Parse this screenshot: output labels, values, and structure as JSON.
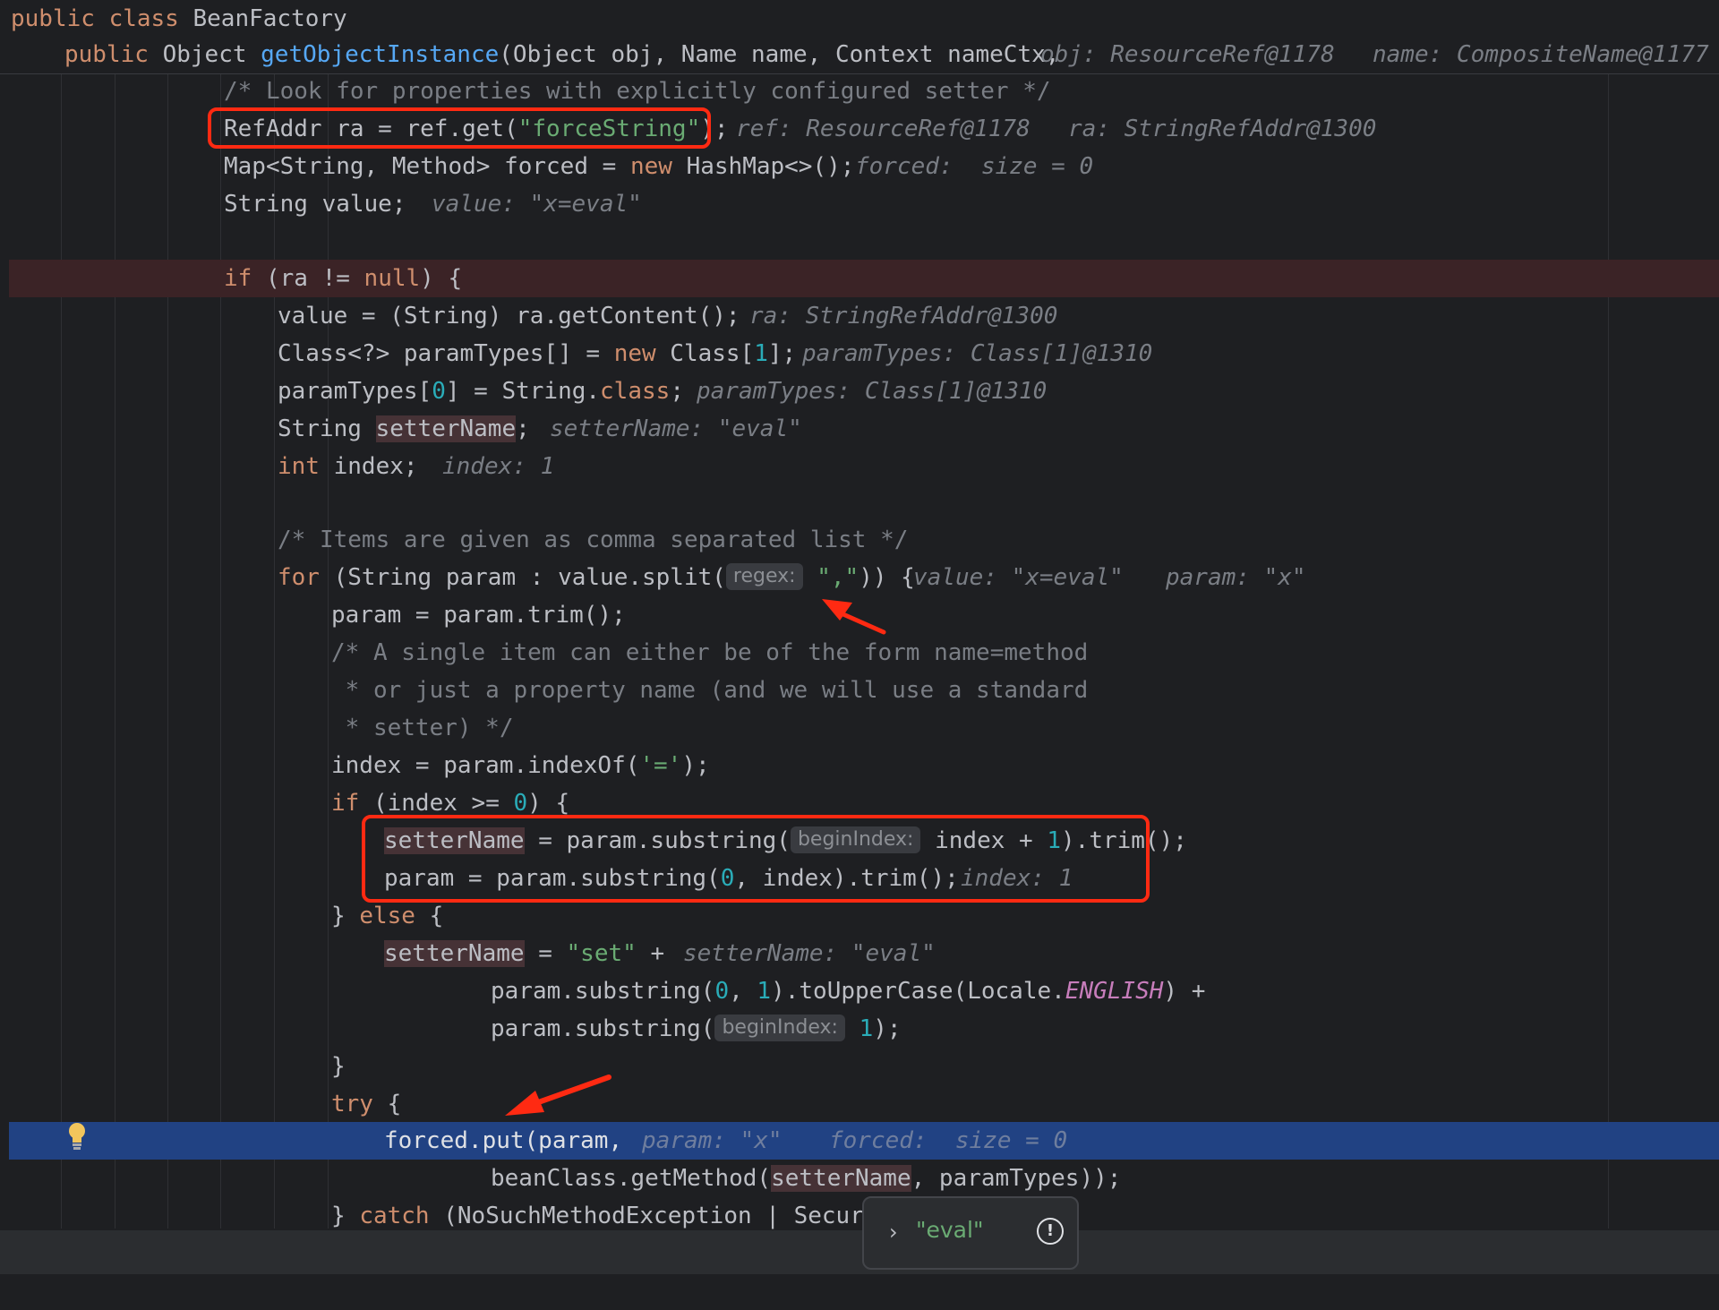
{
  "editor": {
    "header_line_1": {
      "kw": "public class",
      "rest": " BeanFactory"
    },
    "header_line_2": {
      "kw": "public",
      "type": " Object ",
      "method": "getObjectInstance",
      "params": "(Object obj, Name name, Context nameCtx,",
      "hint_obj": "obj: ResourceRef@1178",
      "hint_name": "name: CompositeName@1177"
    },
    "lines": {
      "l1": {
        "comment": "/* Look for properties with explicitly configured setter */"
      },
      "l2": {
        "pre": "RefAddr ra = ref.get(",
        "str": "\"forceString\"",
        "post": ");",
        "hint_ref": "ref: ResourceRef@1178",
        "hint_ra": "ra: StringRefAddr@1300"
      },
      "l3": {
        "pre": "Map<String, Method> forced = ",
        "kw": "new",
        "post": " HashMap<>();",
        "hint": "forced:  size = 0"
      },
      "l4": {
        "pre": "String value;",
        "hint": "value: \"x=eval\""
      },
      "l6": {
        "kw_if": "if",
        "pre": " (ra != ",
        "kw_null": "null",
        "post": ") {"
      },
      "l7": {
        "pre": "value = (String) ra.getContent();",
        "hint": "ra: StringRefAddr@1300"
      },
      "l8": {
        "pre": "Class<?> paramTypes[] = ",
        "kw": "new",
        "mid": " Class[",
        "num": "1",
        "post": "];",
        "hint": "paramTypes: Class[1]@1310"
      },
      "l9": {
        "pre": "paramTypes[",
        "num": "0",
        "mid": "] = String.",
        "kw": "class",
        "post": ";",
        "hint": "paramTypes: Class[1]@1310"
      },
      "l10": {
        "pre": "String ",
        "var": "setterName",
        "post": ";",
        "hint": "setterName: \"eval\""
      },
      "l11": {
        "kw": "int",
        "post": " index;",
        "hint": "index: 1"
      },
      "l13": {
        "comment": "/* Items are given as comma separated list */"
      },
      "l14": {
        "kw": "for",
        "pre": " (String param : value.split(",
        "pill": "regex:",
        "str": "\",\"",
        "post": ")) {",
        "hint_value": "value: \"x=eval\"",
        "hint_param": "param: \"x\""
      },
      "l15": {
        "pre": "param = param.trim();"
      },
      "l16": {
        "comment": "/* A single item can either be of the form name=method"
      },
      "l17": {
        "comment": " * or just a property name (and we will use a standard"
      },
      "l18": {
        "comment": " * setter) */"
      },
      "l19": {
        "pre": "index = param.indexOf(",
        "str": "'='",
        "post": ");"
      },
      "l20": {
        "kw": "if",
        "pre": " (index >= ",
        "num": "0",
        "post": ") {"
      },
      "l21": {
        "var": "setterName",
        "pre": " = param.substring(",
        "pill": "beginIndex:",
        "mid": " index + ",
        "num": "1",
        "post": ").trim();"
      },
      "l22": {
        "pre": "param = param.substring(",
        "num": "0",
        "post": ", index).trim();",
        "hint": "index: 1"
      },
      "l23": {
        "pre": "} ",
        "kw": "else",
        "post": " {"
      },
      "l24": {
        "var": "setterName",
        "pre": " = ",
        "str": "\"set\"",
        "post": " +",
        "hint": "setterName: \"eval\""
      },
      "l25": {
        "pre": "param.substring(",
        "num0": "0",
        "mid": ", ",
        "num1": "1",
        "post": ").toUpperCase(Locale.",
        "ital": "ENGLISH",
        "end": ") +"
      },
      "l26": {
        "pre": "param.substring(",
        "pill": "beginIndex:",
        "num": "1",
        "post": ");"
      },
      "l27": {
        "pre": "}"
      },
      "l28": {
        "kw": "try",
        "post": " {"
      },
      "l29": {
        "pre": "forced.put(param,",
        "hint_param": "param: \"x\"",
        "hint_forced": "forced:  size = 0"
      },
      "l30": {
        "pre": "beanClass.getMethod(",
        "var": "setterName",
        "post": ", paramTypes));"
      },
      "l31": {
        "pre": "} ",
        "kw": "catch",
        "post": " (NoSuchMethodException | Securit"
      }
    }
  },
  "popup": {
    "value": "\"eval\"",
    "expand_icon": "chevron-right-icon",
    "info_icon": "info-circle-icon"
  },
  "annotation_colors": {
    "box": "#ff2a12",
    "arrow": "#ff2a12"
  },
  "icons": {
    "gutter": "lightbulb-icon"
  }
}
